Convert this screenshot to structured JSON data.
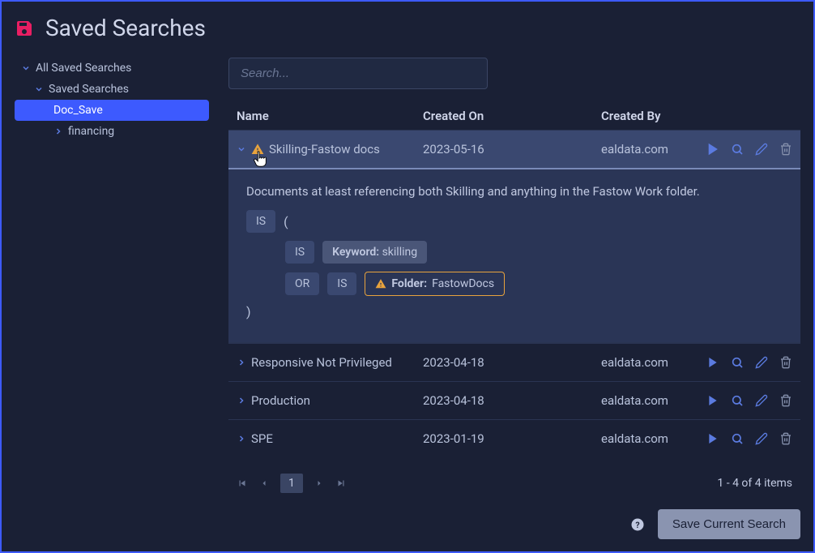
{
  "header": {
    "title": "Saved Searches"
  },
  "sidebar": {
    "root": "All Saved Searches",
    "group": "Saved Searches",
    "items": [
      {
        "label": "Doc_Save",
        "selected": true
      },
      {
        "label": "financing",
        "selected": false
      }
    ]
  },
  "search": {
    "placeholder": "Search..."
  },
  "columns": {
    "name": "Name",
    "created_on": "Created On",
    "created_by": "Created By"
  },
  "rows": [
    {
      "name": "Skilling-Fastow docs",
      "date": "2023-05-16",
      "by": "ealdata.com",
      "expanded": true,
      "warn": true
    },
    {
      "name": "Responsive Not Privileged",
      "date": "2023-04-18",
      "by": "ealdata.com",
      "expanded": false
    },
    {
      "name": "Production",
      "date": "2023-04-18",
      "by": "ealdata.com",
      "expanded": false
    },
    {
      "name": "SPE",
      "date": "2023-01-19",
      "by": "ealdata.com",
      "expanded": false
    }
  ],
  "detail": {
    "description": "Documents at least referencing both Skilling and anything in the Fastow Work folder.",
    "op_is": "IS",
    "op_or": "OR",
    "paren_open": "(",
    "paren_close": ")",
    "keyword_label": "Keyword:",
    "keyword_value": "skilling",
    "folder_label": "Folder:",
    "folder_value": "FastowDocs"
  },
  "pager": {
    "page": "1",
    "summary": "1 - 4 of 4 items"
  },
  "footer": {
    "save": "Save Current Search"
  }
}
